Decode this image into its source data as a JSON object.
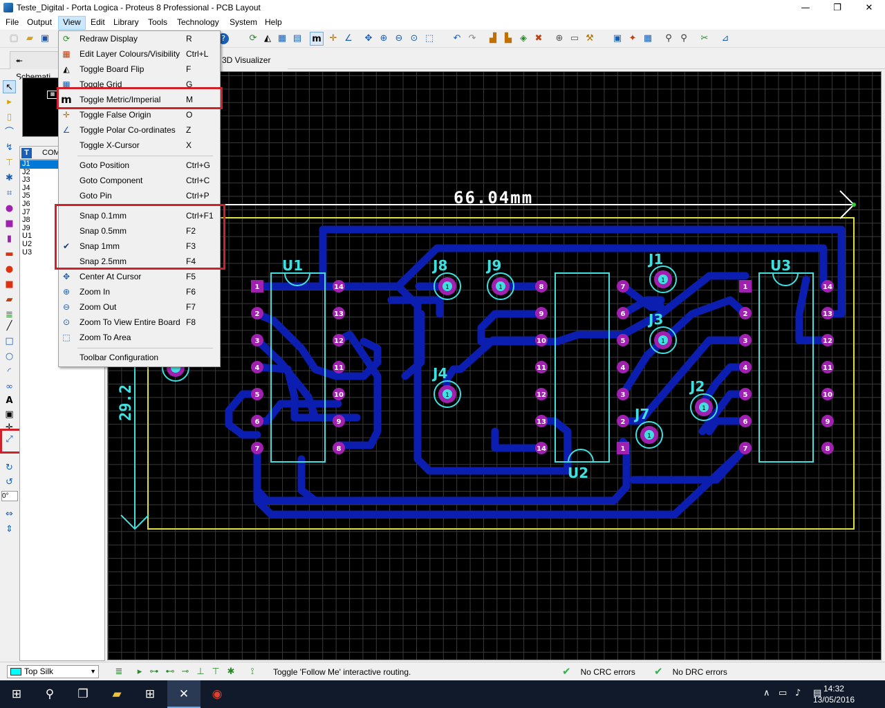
{
  "window": {
    "title": "Teste_Digital - Porta Logica - Proteus 8 Professional - PCB Layout",
    "minimize": "—",
    "maximize": "❐",
    "close": "✕"
  },
  "menubar": [
    "File",
    "Output",
    "View",
    "Edit",
    "Library",
    "Tools",
    "Technology",
    "System",
    "Help"
  ],
  "tabs": [
    {
      "label": "Schemati"
    },
    {
      "label": "3D Visualizer",
      "close": "✕"
    }
  ],
  "view_menu": {
    "items": [
      {
        "icon": "redraw-icon",
        "glyph": "⟳",
        "label": "Redraw Display",
        "shortcut": "R"
      },
      {
        "icon": "layer-colours-icon",
        "glyph": "▦",
        "label": "Edit Layer Colours/Visibility",
        "shortcut": "Ctrl+L"
      },
      {
        "icon": "board-flip-icon",
        "glyph": "◭",
        "label": "Toggle Board Flip",
        "shortcut": "F"
      },
      {
        "icon": "grid-icon",
        "glyph": "▦",
        "label": "Toggle Grid",
        "shortcut": "G"
      },
      {
        "icon": "metric-imperial-icon",
        "glyph": "m",
        "label": "Toggle Metric/Imperial",
        "shortcut": "M"
      },
      {
        "icon": "false-origin-icon",
        "glyph": "✛",
        "label": "Toggle False Origin",
        "shortcut": "O"
      },
      {
        "icon": "polar-icon",
        "glyph": "∠",
        "label": "Toggle Polar Co-ordinates",
        "shortcut": "Z"
      },
      {
        "icon": "",
        "glyph": "",
        "label": "Toggle X-Cursor",
        "shortcut": "X"
      },
      {
        "icon": "",
        "glyph": "",
        "label": "Goto Position",
        "shortcut": "Ctrl+G"
      },
      {
        "icon": "",
        "glyph": "",
        "label": "Goto Component",
        "shortcut": "Ctrl+C"
      },
      {
        "icon": "",
        "glyph": "",
        "label": "Goto Pin",
        "shortcut": "Ctrl+P"
      },
      {
        "icon": "",
        "glyph": "",
        "label": "Snap 0.1mm",
        "shortcut": "Ctrl+F1"
      },
      {
        "icon": "",
        "glyph": "",
        "label": "Snap 0.5mm",
        "shortcut": "F2"
      },
      {
        "icon": "check-icon",
        "glyph": "✔",
        "label": "Snap 1mm",
        "shortcut": "F3"
      },
      {
        "icon": "",
        "glyph": "",
        "label": "Snap 2.5mm",
        "shortcut": "F4"
      },
      {
        "icon": "center-cursor-icon",
        "glyph": "✥",
        "label": "Center At Cursor",
        "shortcut": "F5"
      },
      {
        "icon": "zoom-in-icon",
        "glyph": "⊕",
        "label": "Zoom In",
        "shortcut": "F6"
      },
      {
        "icon": "zoom-out-icon",
        "glyph": "⊖",
        "label": "Zoom Out",
        "shortcut": "F7"
      },
      {
        "icon": "zoom-board-icon",
        "glyph": "⊙",
        "label": "Zoom To View Entire Board",
        "shortcut": "F8"
      },
      {
        "icon": "zoom-area-icon",
        "glyph": "⬚",
        "label": "Zoom To Area",
        "shortcut": ""
      },
      {
        "icon": "",
        "glyph": "",
        "label": "Toolbar Configuration",
        "shortcut": ""
      }
    ]
  },
  "component_panel": {
    "header_letter": "T",
    "header": "COM",
    "items": [
      "J1",
      "J2",
      "J3",
      "J4",
      "J5",
      "J6",
      "J7",
      "J8",
      "J9",
      "U1",
      "U2",
      "U3"
    ]
  },
  "angle_field": "0°",
  "pcb": {
    "width_dimension": "66.04mm",
    "height_dimension": "29.2",
    "chip_labels": [
      "U1",
      "U2",
      "U3"
    ],
    "jumper_labels": [
      "J8",
      "J9",
      "J1",
      "J3",
      "J4",
      "J2",
      "J7"
    ],
    "pad_numbers": [
      "1",
      "2",
      "3",
      "4",
      "5",
      "6",
      "7",
      "8",
      "9",
      "10",
      "11",
      "12",
      "13",
      "14"
    ]
  },
  "statusbar": {
    "layer": "Top Silk",
    "message": "Toggle 'Follow Me' interactive routing.",
    "crc": "No CRC errors",
    "drc": "No DRC errors"
  },
  "taskbar": {
    "time": "14:32",
    "date": "13/05/2016"
  },
  "colors": {
    "track": "#0c1eb0",
    "pad": "#a020b0",
    "silk": "#40e0e0",
    "board_edge": "#e0e040",
    "highlight": "#d0212b",
    "menu_active": "#cce8ff"
  }
}
